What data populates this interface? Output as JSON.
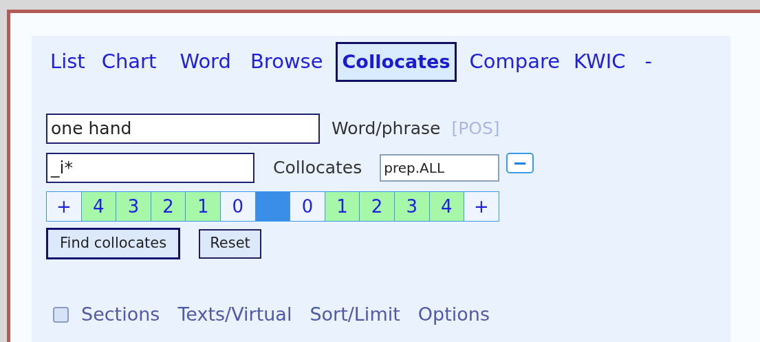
{
  "tabs": [
    {
      "label": "List",
      "selected": false
    },
    {
      "label": "Chart",
      "selected": false
    },
    {
      "label": "Word",
      "selected": false
    },
    {
      "label": "Browse",
      "selected": false
    },
    {
      "label": "Collocates",
      "selected": true
    },
    {
      "label": "Compare",
      "selected": false
    },
    {
      "label": "KWIC",
      "selected": false
    },
    {
      "label": "-",
      "selected": false
    }
  ],
  "word_field": {
    "value": "one hand",
    "label": "Word/phrase",
    "pos_link": "[POS]"
  },
  "collocate_field": {
    "value": "_i*",
    "label": "Collocates",
    "pos_value": "prep.ALL",
    "collapse": "−"
  },
  "slots": [
    {
      "kind": "slot",
      "label": "+",
      "selected": false
    },
    {
      "kind": "slot",
      "label": "4",
      "selected": true
    },
    {
      "kind": "slot",
      "label": "3",
      "selected": true
    },
    {
      "kind": "slot",
      "label": "2",
      "selected": true
    },
    {
      "kind": "slot",
      "label": "1",
      "selected": true
    },
    {
      "kind": "slot",
      "label": "0",
      "selected": false
    },
    {
      "kind": "node"
    },
    {
      "kind": "slot",
      "label": "0",
      "selected": false
    },
    {
      "kind": "slot",
      "label": "1",
      "selected": true
    },
    {
      "kind": "slot",
      "label": "2",
      "selected": true
    },
    {
      "kind": "slot",
      "label": "3",
      "selected": true
    },
    {
      "kind": "slot",
      "label": "4",
      "selected": true
    },
    {
      "kind": "slot",
      "label": "+",
      "selected": false
    }
  ],
  "buttons": [
    {
      "label": "Find collocates",
      "default": true
    },
    {
      "label": "Reset",
      "default": false
    }
  ],
  "options": {
    "checked": false,
    "links": [
      "Sections",
      "Texts/Virtual",
      "Sort/Limit",
      "Options"
    ]
  }
}
